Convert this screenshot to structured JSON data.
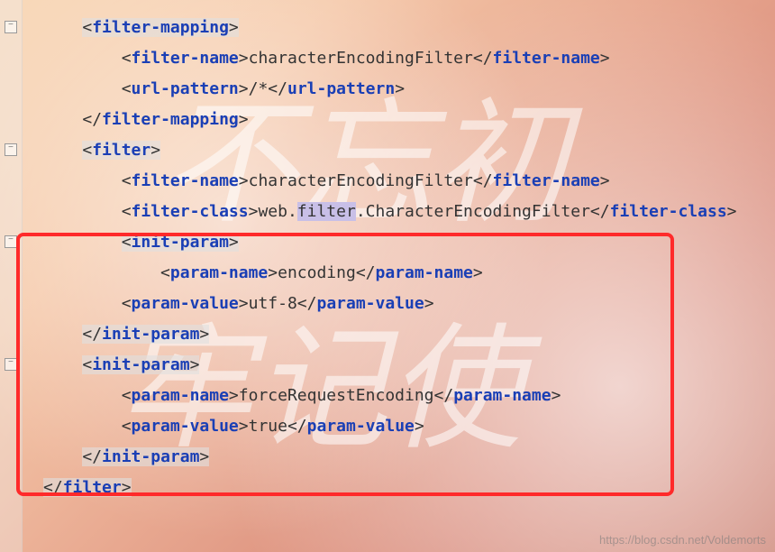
{
  "lines": [
    {
      "indent": 1,
      "parts": [
        {
          "kind": "open",
          "name": "filter-mapping",
          "bg": true
        }
      ]
    },
    {
      "indent": 2,
      "parts": [
        {
          "kind": "open",
          "name": "filter-name"
        },
        {
          "kind": "text",
          "text": "characterEncodingFilter"
        },
        {
          "kind": "close",
          "name": "filter-name"
        }
      ]
    },
    {
      "indent": 2,
      "parts": [
        {
          "kind": "open",
          "name": "url-pattern"
        },
        {
          "kind": "text",
          "text": "/*"
        },
        {
          "kind": "close",
          "name": "url-pattern"
        }
      ]
    },
    {
      "indent": 1,
      "parts": [
        {
          "kind": "close",
          "name": "filter-mapping"
        }
      ]
    },
    {
      "indent": 1,
      "parts": [
        {
          "kind": "open",
          "name": "filter",
          "bg": true
        }
      ]
    },
    {
      "indent": 2,
      "parts": [
        {
          "kind": "open",
          "name": "filter-name"
        },
        {
          "kind": "text",
          "text": "characterEncodingFilter"
        },
        {
          "kind": "close",
          "name": "filter-name"
        }
      ]
    },
    {
      "indent": 2,
      "parts": [
        {
          "kind": "open",
          "name": "filter-class"
        },
        {
          "kind": "text",
          "text": "web."
        },
        {
          "kind": "text",
          "text": "filter",
          "sel": true
        },
        {
          "kind": "text",
          "text": ".CharacterEncodingFilter"
        },
        {
          "kind": "close",
          "name": "filter-class"
        }
      ]
    },
    {
      "indent": 2,
      "parts": [
        {
          "kind": "open",
          "name": "init-param",
          "bg": true
        }
      ]
    },
    {
      "indent": 3,
      "parts": [
        {
          "kind": "open",
          "name": "param-name"
        },
        {
          "kind": "text",
          "text": "encoding"
        },
        {
          "kind": "close",
          "name": "param-name"
        }
      ]
    },
    {
      "indent": 2,
      "parts": [
        {
          "kind": "open",
          "name": "param-value"
        },
        {
          "kind": "text",
          "text": "utf-8"
        },
        {
          "kind": "close",
          "name": "param-value"
        }
      ]
    },
    {
      "indent": 1,
      "parts": [
        {
          "kind": "close",
          "name": "init-param",
          "bg": true
        }
      ]
    },
    {
      "indent": 1,
      "parts": [
        {
          "kind": "open",
          "name": "init-param",
          "bg": true
        }
      ]
    },
    {
      "indent": 2,
      "parts": [
        {
          "kind": "open",
          "name": "param-name"
        },
        {
          "kind": "text",
          "text": "forceRequestEncoding"
        },
        {
          "kind": "close",
          "name": "param-name"
        }
      ]
    },
    {
      "indent": 2,
      "parts": [
        {
          "kind": "open",
          "name": "param-value"
        },
        {
          "kind": "text",
          "text": "true"
        },
        {
          "kind": "close",
          "name": "param-value"
        }
      ]
    },
    {
      "indent": 1,
      "parts": [
        {
          "kind": "close",
          "name": "init-param",
          "bg": true
        }
      ]
    },
    {
      "indent": 0,
      "parts": [
        {
          "kind": "close",
          "name": "filter",
          "bg": true
        }
      ]
    }
  ],
  "indent_unit": "    ",
  "gutter_folds": [
    0,
    4,
    7,
    11
  ],
  "watermark": "https://blog.csdn.net/Voldemorts",
  "calligraphy": {
    "top": "不忘初",
    "bottom": "牢记使"
  }
}
